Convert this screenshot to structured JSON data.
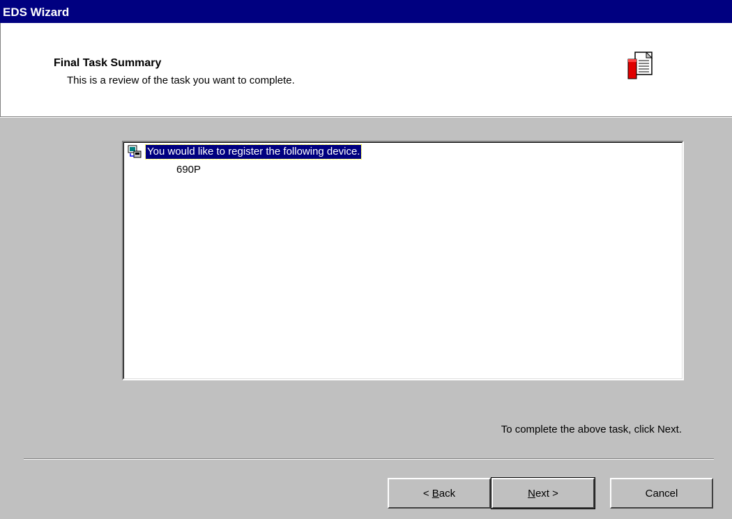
{
  "window": {
    "title": "EDS Wizard"
  },
  "header": {
    "title": "Final Task Summary",
    "subtitle": "This is a review of the task you want to complete.",
    "icon": "document-icon"
  },
  "summary": {
    "item_label": "You would like to register the following device.",
    "item_icon": "device-icon",
    "child_value": "690P"
  },
  "instruction": "To complete the above task, click Next.",
  "buttons": {
    "back": {
      "prefix": "< ",
      "mnemonic": "B",
      "rest": "ack"
    },
    "next": {
      "mnemonic": "N",
      "rest": "ext",
      "suffix": " >"
    },
    "cancel": "Cancel"
  },
  "colors": {
    "titlebar": "#000080",
    "selection": "#000080",
    "face": "#c0c0c0"
  }
}
